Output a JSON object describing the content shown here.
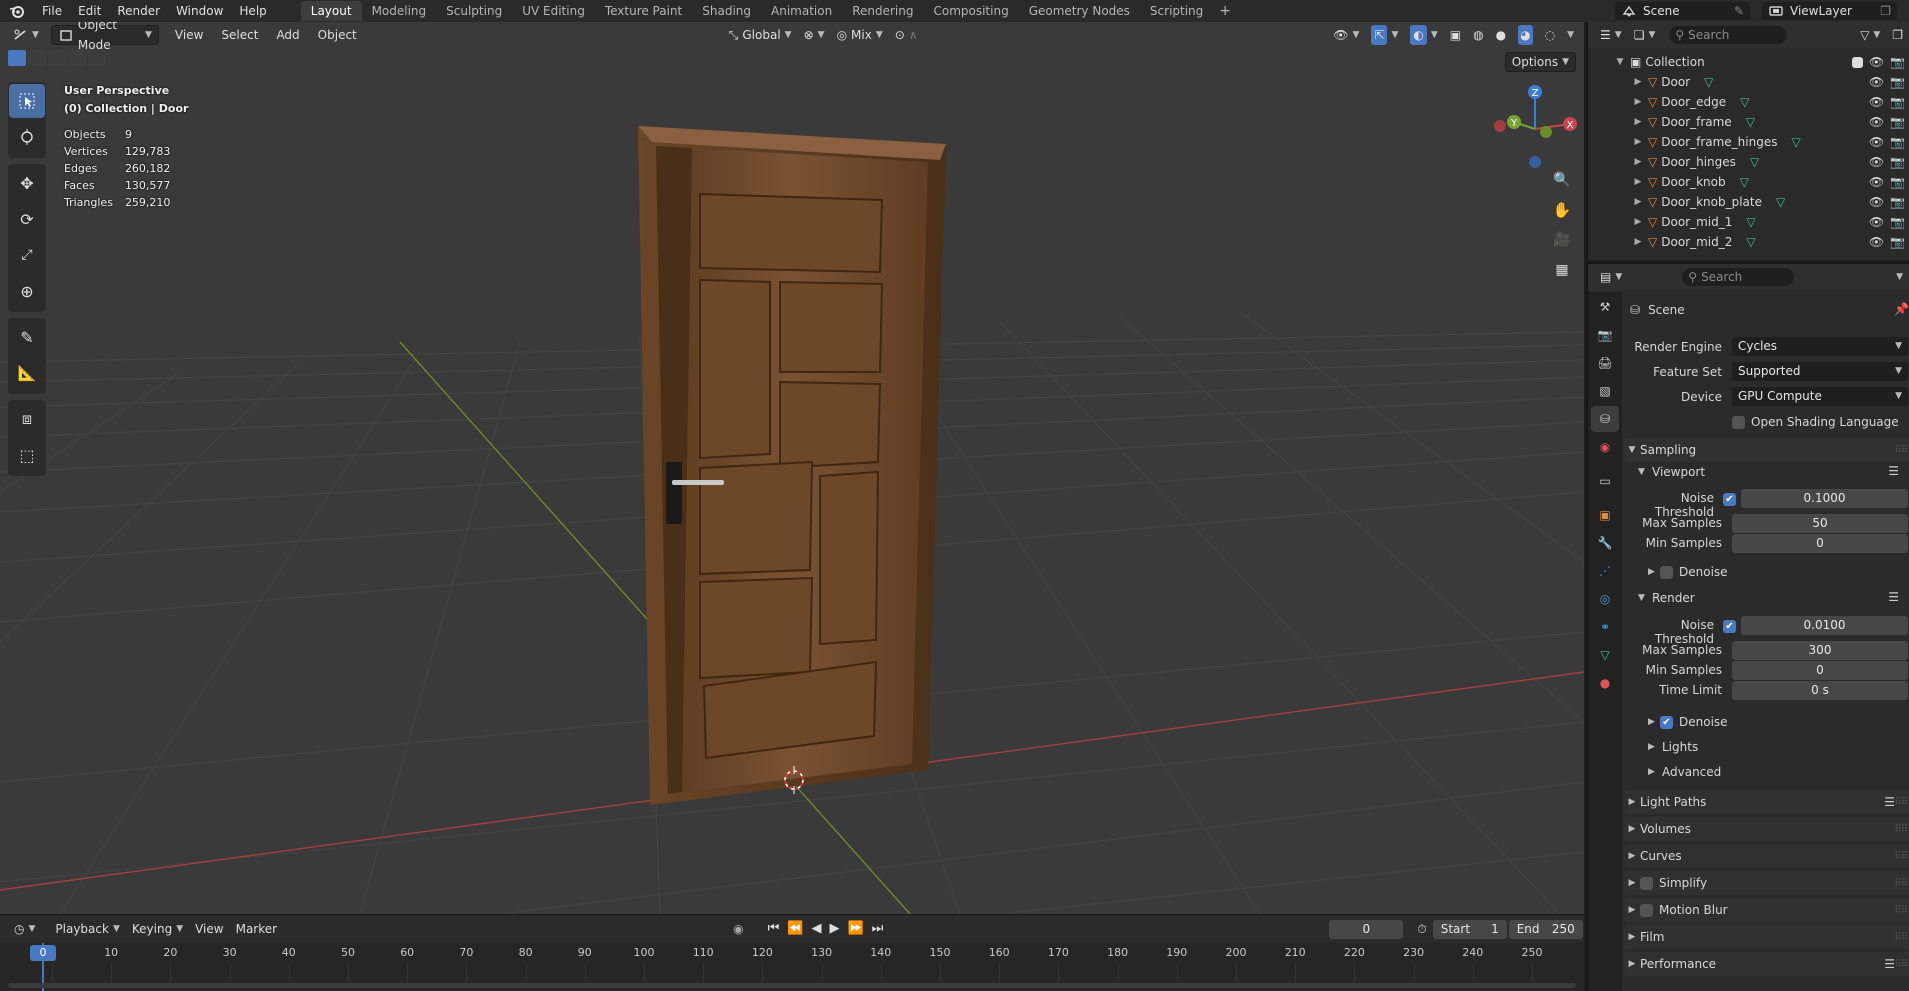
{
  "menu": {
    "items": [
      "File",
      "Edit",
      "Render",
      "Window",
      "Help"
    ],
    "workspaces": [
      "Layout",
      "Modeling",
      "Sculpting",
      "UV Editing",
      "Texture Paint",
      "Shading",
      "Animation",
      "Rendering",
      "Compositing",
      "Geometry Nodes",
      "Scripting"
    ],
    "active_workspace": "Layout",
    "add_tab": "+",
    "scene": "Scene",
    "view_layer": "ViewLayer"
  },
  "viewport": {
    "mode": "Object Mode",
    "menus": [
      "View",
      "Select",
      "Add",
      "Object"
    ],
    "transform_orientation": "Global",
    "snap_mode": "Mix",
    "options_label": "Options",
    "overlay_title": "User Perspective",
    "overlay_context": "(0) Collection | Door",
    "stats": [
      {
        "label": "Objects",
        "value": "9"
      },
      {
        "label": "Vertices",
        "value": "129,783"
      },
      {
        "label": "Edges",
        "value": "260,182"
      },
      {
        "label": "Faces",
        "value": "130,577"
      },
      {
        "label": "Triangles",
        "value": "259,210"
      }
    ],
    "gizmo": {
      "x": "X",
      "y": "Y",
      "z": "Z"
    }
  },
  "timeline": {
    "menus": [
      "Playback",
      "Keying",
      "View",
      "Marker"
    ],
    "current_frame": "0",
    "start_label": "Start",
    "start_value": "1",
    "end_label": "End",
    "end_value": "250",
    "ruler_marks": [
      "0",
      "10",
      "20",
      "30",
      "40",
      "50",
      "60",
      "70",
      "80",
      "90",
      "100",
      "110",
      "120",
      "130",
      "140",
      "150",
      "160",
      "170",
      "180",
      "190",
      "200",
      "210",
      "220",
      "230",
      "240",
      "250"
    ]
  },
  "outliner": {
    "search_placeholder": "Search",
    "collection": "Collection",
    "objects": [
      "Door",
      "Door_edge",
      "Door_frame",
      "Door_frame_hinges",
      "Door_hinges",
      "Door_knob",
      "Door_knob_plate",
      "Door_mid_1",
      "Door_mid_2"
    ]
  },
  "properties": {
    "search_placeholder": "Search",
    "context": "Scene",
    "render_engine_label": "Render Engine",
    "render_engine": "Cycles",
    "feature_set_label": "Feature Set",
    "feature_set": "Supported",
    "device_label": "Device",
    "device": "GPU Compute",
    "osl_label": "Open Shading Language",
    "sampling": "Sampling",
    "viewport_sub": "Viewport",
    "noise_threshold_label": "Noise Threshold",
    "viewport_noise_threshold": "0.1000",
    "max_samples_label": "Max Samples",
    "viewport_max_samples": "50",
    "min_samples_label": "Min Samples",
    "viewport_min_samples": "0",
    "denoise_label": "Denoise",
    "render_sub": "Render",
    "render_noise_threshold": "0.0100",
    "render_max_samples": "300",
    "render_min_samples": "0",
    "time_limit_label": "Time Limit",
    "time_limit": "0 s",
    "lights": "Lights",
    "advanced": "Advanced",
    "panels": [
      "Light Paths",
      "Volumes",
      "Curves",
      "Simplify",
      "Motion Blur",
      "Film",
      "Performance"
    ]
  },
  "colors": {
    "accent": "#4a79c4",
    "axis_x": "#c8454a",
    "axis_y": "#7aa337",
    "axis_z": "#3b7ed8",
    "object_icon": "#e58a3c",
    "mesh_data_icon": "#3dbd8e"
  }
}
